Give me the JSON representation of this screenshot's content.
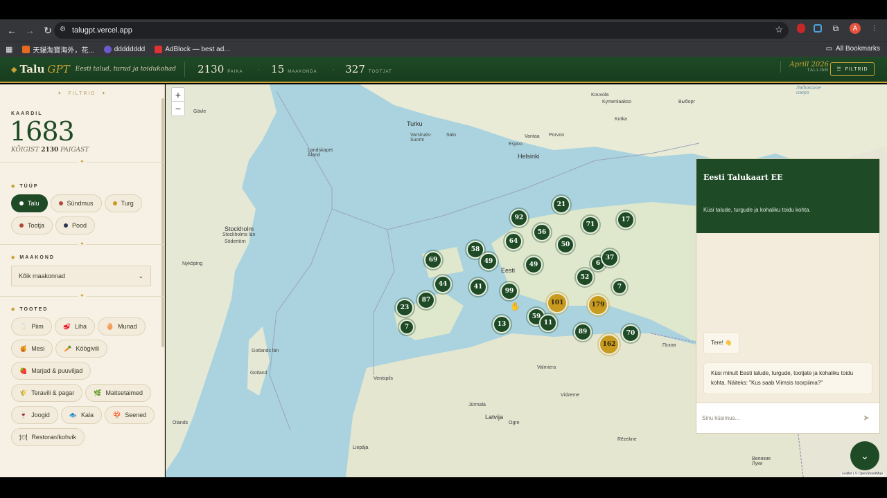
{
  "browser": {
    "url": "talugpt.vercel.app",
    "bookmarks": [
      "天貓淘寶海外，花...",
      "dddddddd",
      "AdBlock — best ad..."
    ],
    "all_bookmarks": "All Bookmarks",
    "avatar": "A"
  },
  "header": {
    "logo_main": "Talu",
    "logo_accent": "GPT",
    "tagline": "Eesti talud, turud ja toidukohad",
    "stats": [
      {
        "num": "2130",
        "label": "PAIKA"
      },
      {
        "num": "15",
        "label": "MAAKONDA"
      },
      {
        "num": "327",
        "label": "TOOTJAT"
      }
    ],
    "date": "Aprill 2026",
    "date_city": "TALLINN",
    "filter_label": "FILTRID"
  },
  "sidebar": {
    "title": "FILTRID",
    "on_map_label": "KAARDIL",
    "on_map_count": "1683",
    "total_prefix": "KÕIGIST",
    "total_count": "2130",
    "total_suffix": "PAIGAST",
    "type_title": "TÜÜP",
    "types": [
      {
        "label": "Talu",
        "color": "#ffffff",
        "active": true
      },
      {
        "label": "Sündmus",
        "color": "#b2473b"
      },
      {
        "label": "Turg",
        "color": "#c89a1e"
      },
      {
        "label": "Tootja",
        "color": "#b2473b"
      },
      {
        "label": "Pood",
        "color": "#2a3550"
      }
    ],
    "county_title": "MAAKOND",
    "county_value": "Kõik maakonnad",
    "products_title": "TOOTED",
    "products": [
      {
        "label": "Piim",
        "icon": "🥛"
      },
      {
        "label": "Liha",
        "icon": "🥩"
      },
      {
        "label": "Munad",
        "icon": "🥚"
      },
      {
        "label": "Mesi",
        "icon": "🍯"
      },
      {
        "label": "Köögivili",
        "icon": "🥕"
      },
      {
        "label": "Marjad & puuviljad",
        "icon": "🍓"
      },
      {
        "label": "Teravili & pagar",
        "icon": "🌾"
      },
      {
        "label": "Maitsetaimed",
        "icon": "🌿"
      },
      {
        "label": "Joogid",
        "icon": "🍷"
      },
      {
        "label": "Kala",
        "icon": "🐟"
      },
      {
        "label": "Seened",
        "icon": "🍄"
      },
      {
        "label": "Restoran/kohvik",
        "icon": "🍽"
      }
    ]
  },
  "map": {
    "labels": [
      "Gävle",
      "Turku",
      "Salo",
      "Porvoo",
      "Kouvola",
      "Vantaa",
      "Espoo",
      "Helsinki",
      "Kymenlaakso",
      "Kotka",
      "Выборг",
      "Ладожское озеро",
      "Stockholm",
      "Stockholms län",
      "Södertörn",
      "Nyköping",
      "Landskapet Åland",
      "Varsinais-Suomi",
      "Eesti",
      "Gotlands län",
      "Gotland",
      "Ventspils",
      "Jūrmala",
      "Latvija",
      "Valmiera",
      "Rēzekne",
      "Liepāja",
      "Псков",
      "Великие Луки",
      "Ogre",
      "Vidzeme",
      "Olands"
    ],
    "clusters": [
      "21",
      "92",
      "71",
      "17",
      "56",
      "64",
      "50",
      "58",
      "49",
      "49",
      "6",
      "37",
      "69",
      "52",
      "44",
      "41",
      "99",
      "7",
      "87",
      "23",
      "101",
      "179",
      "7",
      "59",
      "11",
      "13",
      "89",
      "70",
      "162"
    ],
    "attribution": "Leaflet | © OpenStreetMap"
  },
  "chat": {
    "title": "Eesti Talukaart EE",
    "subtitle": "Küsi talude, turgude ja kohaliku toidu kohta.",
    "greeting": "Tere! 👋",
    "intro": "Küsi minult Eesti talude, turgude, tootjate ja kohaliku toidu kohta. Näiteks: \"Kus saab Viimsis toorpiima?\"",
    "placeholder": "Sinu küsimus..."
  }
}
